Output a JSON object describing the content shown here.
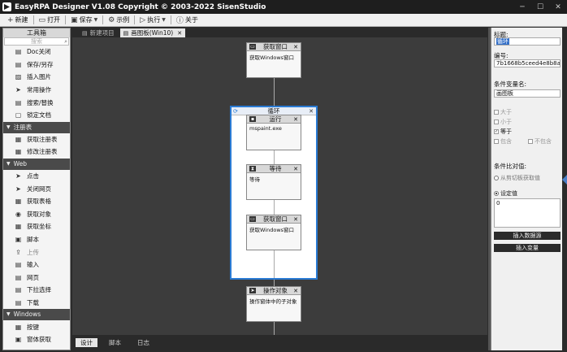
{
  "window": {
    "title": "EasyRPA Designer V1.08   Copyright © 2003-2022 SisenStudio"
  },
  "toolbar": {
    "new_label": "新建",
    "open_label": "打开",
    "save_label": "保存",
    "example_label": "示例",
    "run_label": "执行",
    "about_label": "关于"
  },
  "toolbox": {
    "header": "工具箱",
    "search_placeholder": "搜索",
    "groups": [
      {
        "name": "",
        "items": [
          "Doc关闭",
          "保存/另存",
          "插入图片",
          "常用操作",
          "搜索/替换",
          "锁定文档"
        ]
      },
      {
        "name": "注册表",
        "items": [
          "获取注册表",
          "修改注册表"
        ]
      },
      {
        "name": "Web",
        "items": [
          "点击",
          "关闭网页",
          "获取表格",
          "获取对象",
          "获取坐标",
          "脚本",
          "上传",
          "输入",
          "网页",
          "下拉选择",
          "下载"
        ]
      },
      {
        "name": "Windows",
        "items": [
          "按键",
          "窗体获取"
        ]
      }
    ]
  },
  "tabs": [
    {
      "label": "新建项目",
      "active": false
    },
    {
      "label": "画图板(Win10)",
      "active": true
    }
  ],
  "flow": {
    "top_node": {
      "title": "获取窗口",
      "body": "获取Windows窗口"
    },
    "loop": {
      "title": "循环",
      "nodes": [
        {
          "title": "运行",
          "body": "mspaint.exe"
        },
        {
          "title": "等待",
          "body": "等待"
        },
        {
          "title": "获取窗口",
          "body": "获取Windows窗口"
        }
      ]
    },
    "bottom_node": {
      "title": "操作对象",
      "body": "操作窗体中的子对象"
    }
  },
  "bottom_tabs": [
    "设计",
    "脚本",
    "日志"
  ],
  "properties": {
    "title_label": "标题:",
    "title_value": "循环",
    "id_label": "编号:",
    "id_value": "7b1668b5ceed4e8b8a2",
    "var_label": "条件变量名:",
    "var_value": "画图板",
    "checks": [
      {
        "label": "大于",
        "checked": false
      },
      {
        "label": "小于",
        "checked": false
      },
      {
        "label": "等于",
        "checked": true
      },
      {
        "label": "包含",
        "checked": false
      },
      {
        "label": "不包含",
        "checked": false
      }
    ],
    "compare_label": "条件比对值:",
    "radio_clipboard": "从剪切板获取值",
    "radio_fixed": "设定值",
    "fixed_value": "0",
    "insert_data_btn": "插入数据源",
    "insert_var_btn": "插入变量"
  },
  "colors": {
    "accent": "#2a7bd4",
    "canvas": "#3c3c3c",
    "panel_dark": "#2b2b2b"
  }
}
